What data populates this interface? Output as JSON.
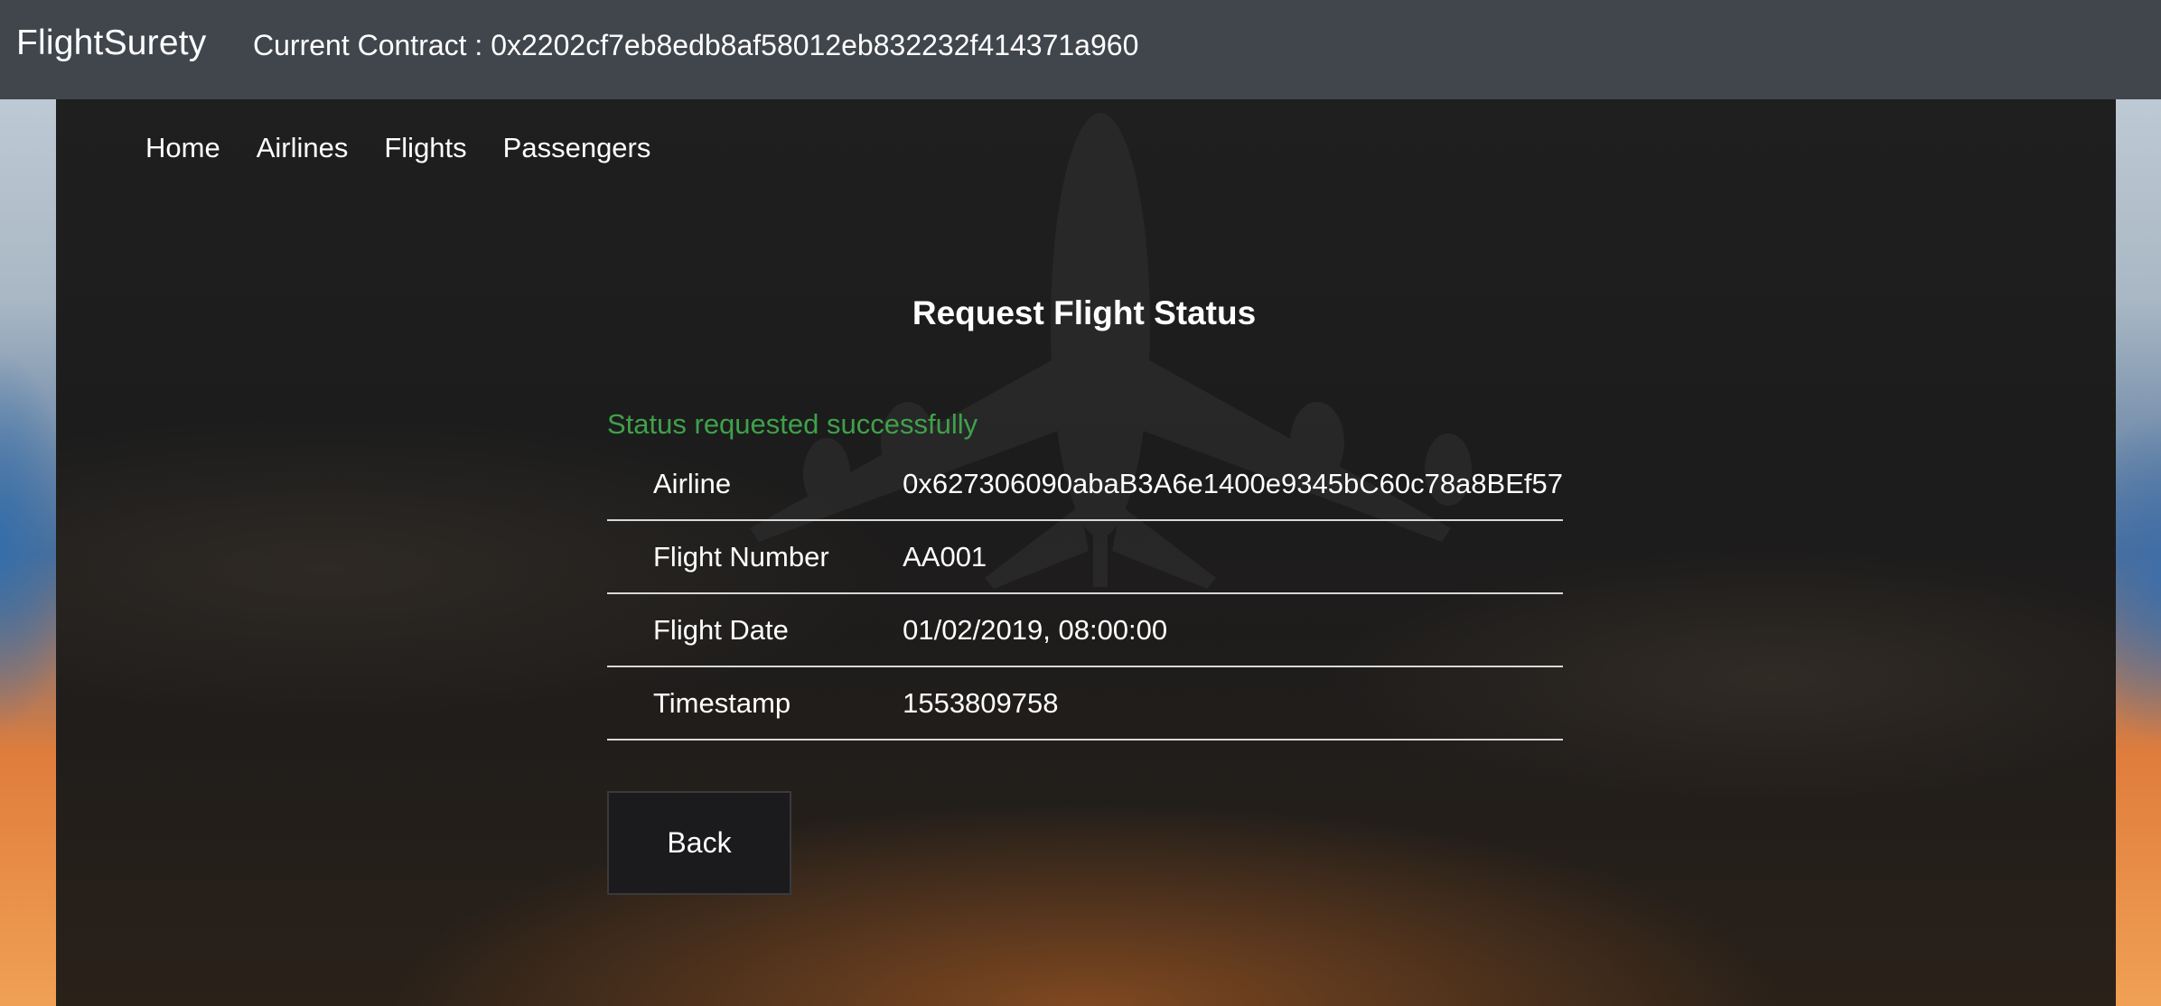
{
  "header": {
    "brand": "FlightSurety",
    "contract_label": "Current Contract : 0x2202cf7eb8edb8af58012eb832232f414371a960"
  },
  "nav": {
    "items": [
      {
        "label": "Home"
      },
      {
        "label": "Airlines"
      },
      {
        "label": "Flights"
      },
      {
        "label": "Passengers"
      }
    ]
  },
  "main": {
    "title": "Request Flight Status",
    "status_message": "Status requested successfully",
    "status_color": "#3fa14a",
    "rows": [
      {
        "key": "Airline",
        "value": "0x627306090abaB3A6e1400e9345bC60c78a8BEf57"
      },
      {
        "key": "Flight Number",
        "value": "AA001"
      },
      {
        "key": "Flight Date",
        "value": "01/02/2019, 08:00:00"
      },
      {
        "key": "Timestamp",
        "value": "1553809758"
      }
    ],
    "back_label": "Back"
  },
  "colors": {
    "topbar": "#41464d",
    "backdrop": "#1c1c1c"
  }
}
